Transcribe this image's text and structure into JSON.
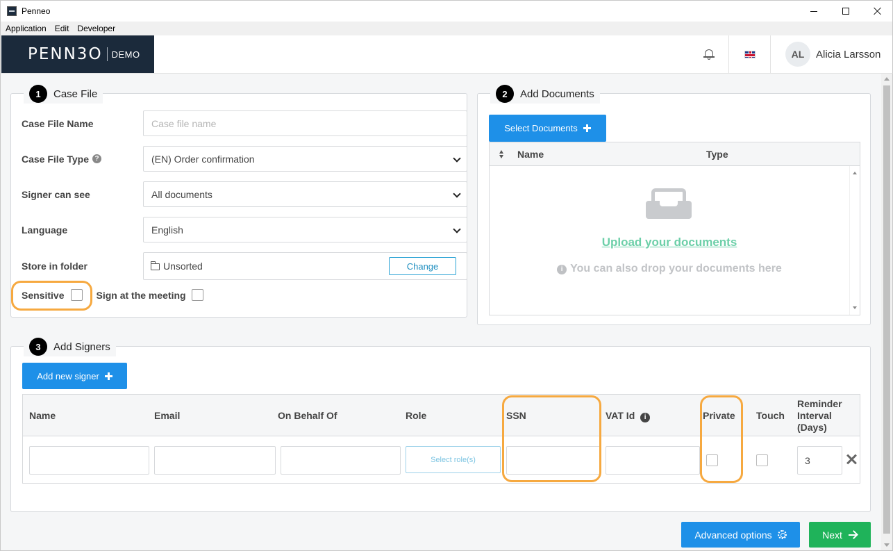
{
  "window": {
    "title": "Penneo"
  },
  "menu": {
    "items": [
      "Application",
      "Edit",
      "Developer"
    ]
  },
  "header": {
    "logo_text": "PENN3O",
    "env_label": "DEMO",
    "bell_icon": "bell-icon",
    "flag_icon": "uk-flag-icon",
    "user_initials": "AL",
    "user_name": "Alicia Larsson"
  },
  "case_file": {
    "step": "1",
    "title": "Case File",
    "name_label": "Case File Name",
    "name_placeholder": "Case file name",
    "type_label": "Case File Type",
    "type_value": "(EN) Order confirmation",
    "signer_label": "Signer can see",
    "signer_value": "All documents",
    "language_label": "Language",
    "language_value": "English",
    "folder_label": "Store in folder",
    "folder_value": "Unsorted",
    "change_label": "Change",
    "sensitive_label": "Sensitive",
    "sensitive_checked": false,
    "meeting_label": "Sign at the meeting",
    "meeting_checked": false
  },
  "documents": {
    "step": "2",
    "title": "Add Documents",
    "select_label": "Select Documents",
    "col_name": "Name",
    "col_type": "Type",
    "upload_link": "Upload your documents",
    "drop_hint": "You can also drop your documents here"
  },
  "signers": {
    "step": "3",
    "title": "Add Signers",
    "add_label": "Add new signer",
    "columns": {
      "name": "Name",
      "email": "Email",
      "on_behalf": "On Behalf Of",
      "role": "Role",
      "ssn": "SSN",
      "vat": "VAT Id",
      "private": "Private",
      "touch": "Touch",
      "reminder_line1": "Reminder",
      "reminder_line2": "Interval",
      "reminder_line3": "(Days)"
    },
    "row": {
      "role_button": "Select role(s)",
      "reminder_value": "3"
    }
  },
  "footer": {
    "advanced_label": "Advanced options",
    "next_label": "Next"
  },
  "colors": {
    "primary_blue": "#1e90e8",
    "next_green": "#1fb35a",
    "highlight_orange": "#f6a940",
    "brand_dark": "#1b2a3b",
    "upload_link_green": "#6ccfa8"
  }
}
